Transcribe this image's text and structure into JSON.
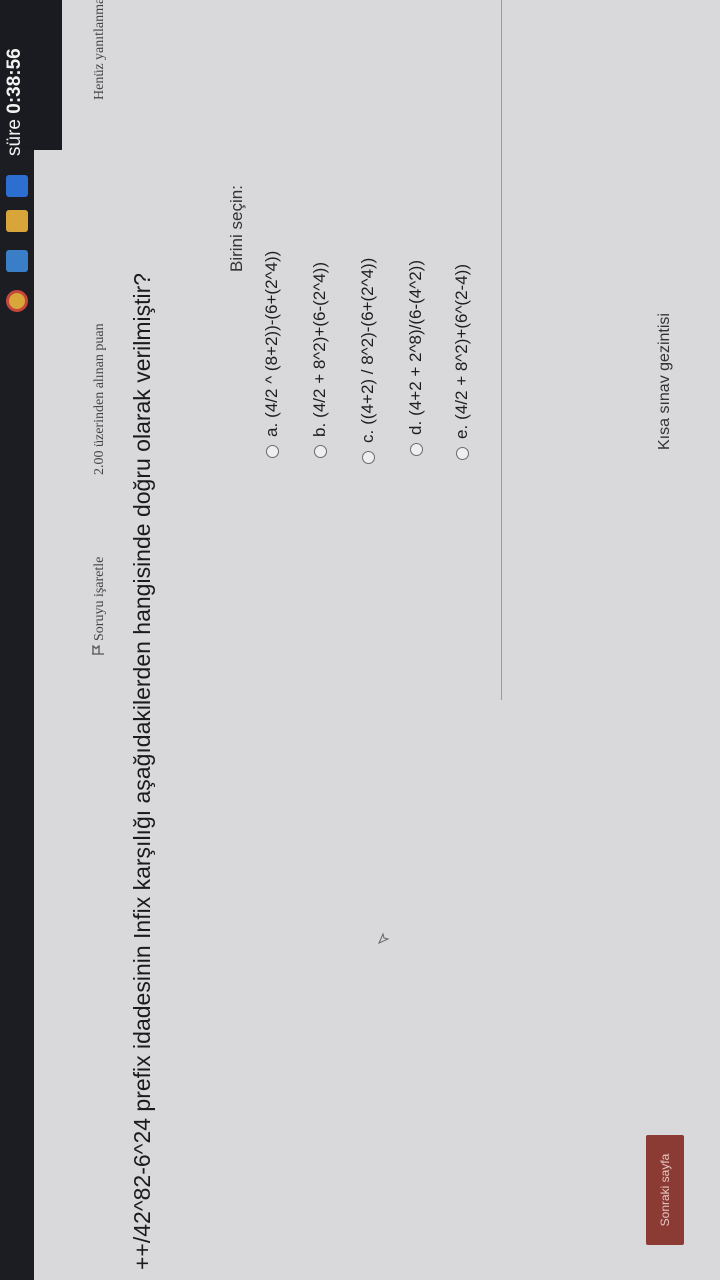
{
  "timer": {
    "label": "süre",
    "value": "0:38:56"
  },
  "question": {
    "status": "Henüz yanıtlanmadı",
    "points": "2.00 üzerinden alınan puan",
    "flag_label": "Soruyu işaretle",
    "text": "++/42^82-6^24 prefix idadesinin Infix karşılığı aşağıdakilerden hangisinde doğru olarak verilmiştir?",
    "choose_label": "Birini seçin:",
    "options": [
      {
        "letter": "a.",
        "text": "(4/2  ^ (8+2))-(6+(2^4))"
      },
      {
        "letter": "b.",
        "text": "(4/2 + 8^2)+(6-(2^4))"
      },
      {
        "letter": "c.",
        "text": "((4+2) / 8^2)-(6+(2^4))"
      },
      {
        "letter": "d.",
        "text": "(4+2 + 2^8)/(6-(4^2))"
      },
      {
        "letter": "e.",
        "text": "(4/2 + 8^2)+(6^(2-4))"
      }
    ]
  },
  "navigation": {
    "title": "Kısa sınav gezintisi"
  },
  "footer": {
    "next_label": "Sonraki sayfa"
  },
  "colors": {
    "accent_button": "#8b3a34",
    "background": "#d9d9db",
    "timer_bg": "#1a1b20"
  }
}
